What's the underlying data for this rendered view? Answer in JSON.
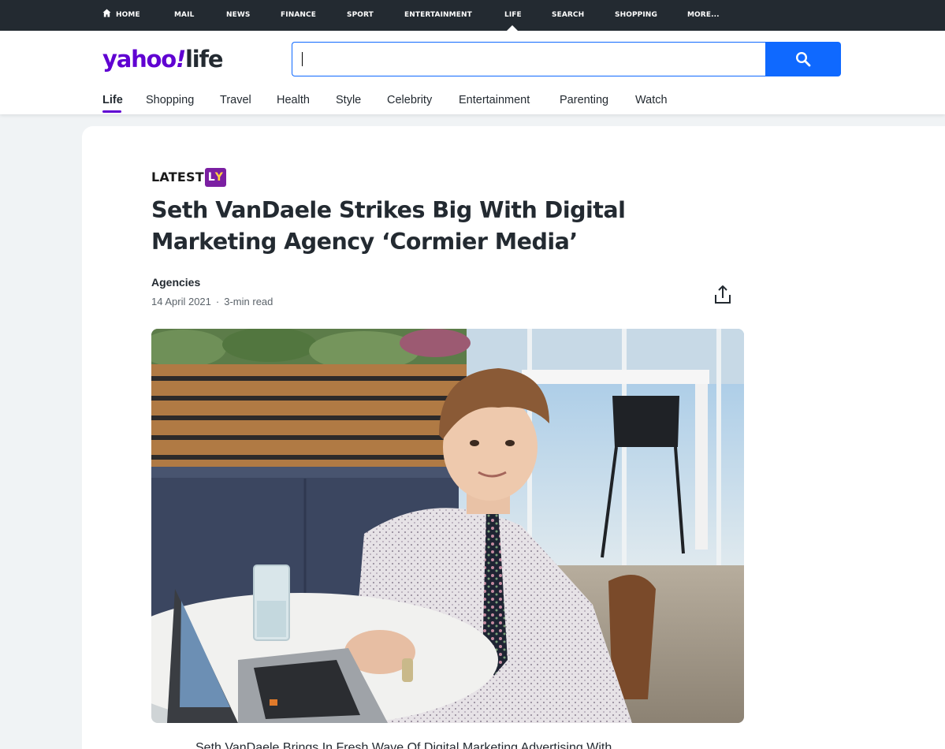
{
  "topnav": {
    "items": [
      "HOME",
      "MAIL",
      "NEWS",
      "FINANCE",
      "SPORT",
      "ENTERTAINMENT",
      "LIFE",
      "SEARCH",
      "SHOPPING",
      "MORE..."
    ]
  },
  "header": {
    "logo_yahoo": "yahoo",
    "logo_bang": "!",
    "logo_life": "life",
    "search_placeholder": "",
    "search_icon": "search-icon"
  },
  "subnav": {
    "items": [
      "Life",
      "Shopping",
      "Travel",
      "Health",
      "Style",
      "Celebrity",
      "Entertainment",
      "Parenting",
      "Watch"
    ],
    "active": "Life"
  },
  "article": {
    "provider_text": "LATEST",
    "provider_badge_l": "L",
    "provider_badge_y": "Y",
    "headline": "Seth VanDaele Strikes Big With Digital Marketing Agency ‘Cormier Media’",
    "author": "Agencies",
    "date": "14 April 2021",
    "read_time": "3-min read",
    "share_icon": "share-icon",
    "body_first_line": "Seth VanDaele Brings In Fresh Wave Of Digital Marketing Advertising With"
  },
  "colors": {
    "brand_purple": "#6001d2",
    "search_blue": "#0f69ff",
    "topbar_bg": "#232a31"
  }
}
